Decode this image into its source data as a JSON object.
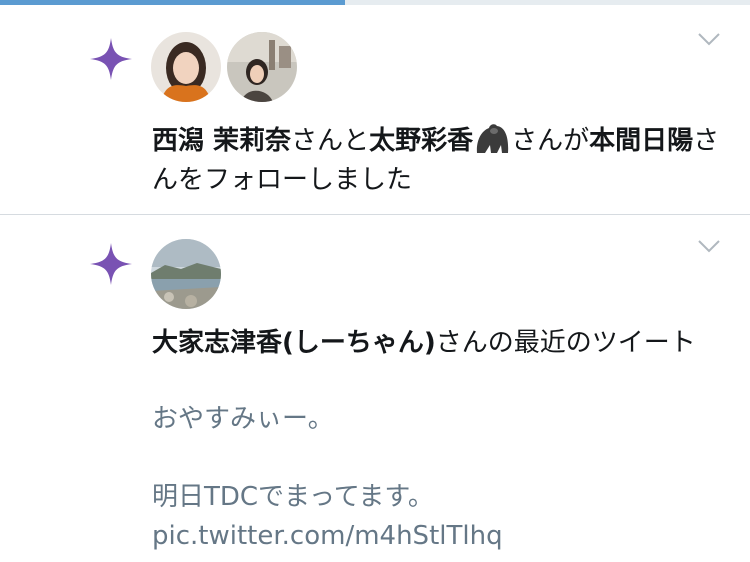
{
  "progress": {
    "fraction": 0.46,
    "color": "#5b9bd1"
  },
  "colors": {
    "accent": "#7952b3",
    "text": "#14171a",
    "muted": "#657786",
    "divider": "#d6dbe0"
  },
  "notifications": [
    {
      "icon": "sparkle-icon",
      "user1": "西潟 茉莉奈",
      "connector1": "さんと",
      "user2": "太野彩香",
      "user2_emoji": "gorilla-emoji",
      "connector2": "さんが",
      "target": "本間日陽",
      "action": "さんをフォローしました"
    },
    {
      "icon": "sparkle-icon",
      "user": "大家志津香(しーちゃん)",
      "suffix": "さんの最近のツイート",
      "tweet_line1": "おやすみぃー。",
      "tweet_line2": "明日TDCでまってます。 pic.twitter.com/m4hStlTlhq"
    }
  ]
}
